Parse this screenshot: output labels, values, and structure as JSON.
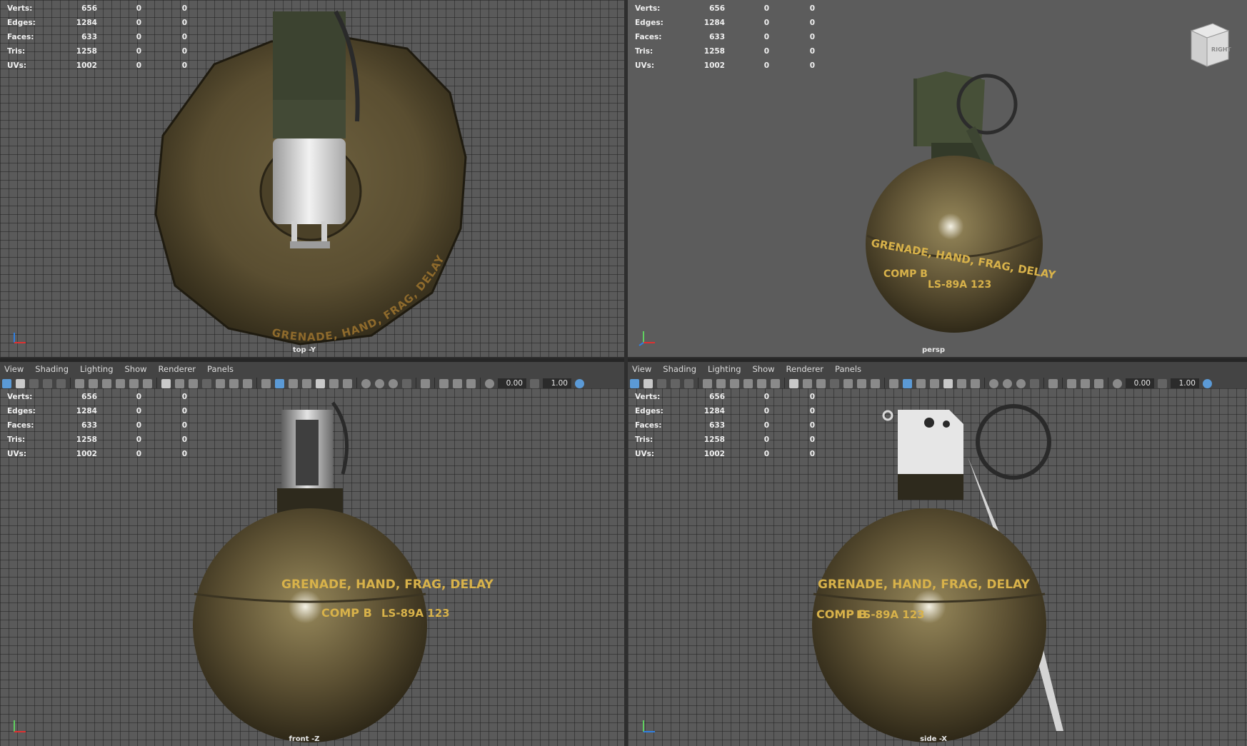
{
  "stats": {
    "rows": [
      {
        "label": "Verts:",
        "v1": "656",
        "v2": "0",
        "v3": "0"
      },
      {
        "label": "Edges:",
        "v1": "1284",
        "v2": "0",
        "v3": "0"
      },
      {
        "label": "Faces:",
        "v1": "633",
        "v2": "0",
        "v3": "0"
      },
      {
        "label": "Tris:",
        "v1": "1258",
        "v2": "0",
        "v3": "0"
      },
      {
        "label": "UVs:",
        "v1": "1002",
        "v2": "0",
        "v3": "0"
      }
    ]
  },
  "viewports": {
    "top": {
      "camera": "top -Y"
    },
    "persp": {
      "camera": "persp",
      "view_cube": "RIGHT"
    },
    "front": {
      "camera": "front -Z"
    },
    "side": {
      "camera": "side -X"
    }
  },
  "menu": [
    "View",
    "Shading",
    "Lighting",
    "Show",
    "Renderer",
    "Panels"
  ],
  "toolbar": {
    "exposure": "0.00",
    "gamma": "1.00"
  },
  "grenade": {
    "label_line1": "GRENADE, HAND, FRAG, DELAY",
    "label_line2_a": "COMP B",
    "label_line2_b": "LS-89A 123",
    "body_color": "#5e5234",
    "text_color": "#d8b24a"
  }
}
